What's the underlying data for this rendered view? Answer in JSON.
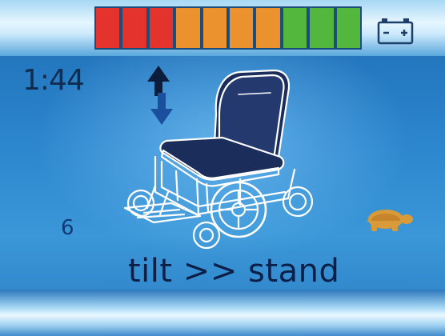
{
  "battery": {
    "segments": [
      {
        "color": "#d9302b"
      },
      {
        "color": "#d9302b"
      },
      {
        "color": "#d9302b"
      },
      {
        "color": "#e08a2c"
      },
      {
        "color": "#e08a2c"
      },
      {
        "color": "#e08a2c"
      },
      {
        "color": "#e08a2c"
      },
      {
        "color": "#4fae3b"
      },
      {
        "color": "#4fae3b"
      },
      {
        "color": "#4fae3b"
      }
    ],
    "icon": "battery-icon"
  },
  "timer": "1:44",
  "actuator_icon": "up-down-arrow-icon",
  "chair_icon": "power-wheelchair-icon",
  "profile_number": "6",
  "mode_text": "tilt >> stand",
  "speed_icon": "turtle-icon",
  "colors": {
    "text_dark": "#0d1f47",
    "chair_outline": "#ffffff",
    "turtle": "#d99a3a"
  }
}
